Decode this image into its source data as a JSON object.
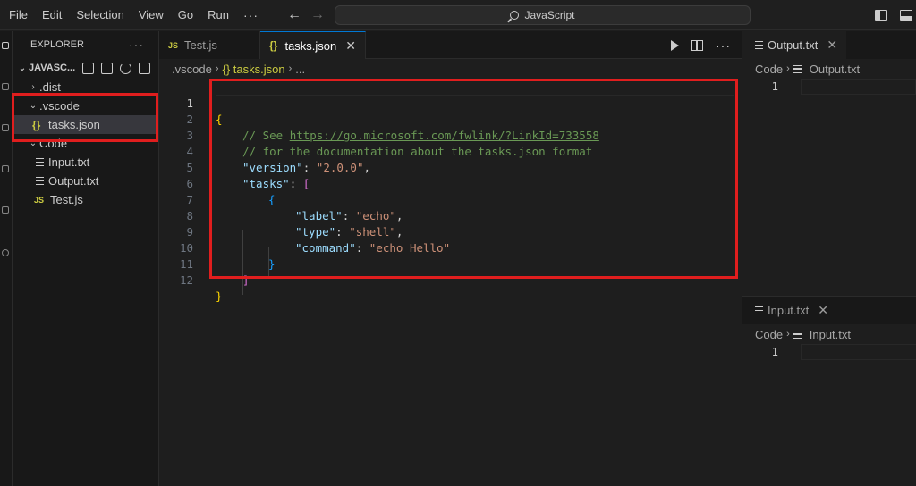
{
  "menu": [
    "File",
    "Edit",
    "Selection",
    "View",
    "Go",
    "Run",
    "···"
  ],
  "nav": {
    "back": "←",
    "forward": "→"
  },
  "command_center": {
    "text": "JavaScript"
  },
  "sidebar": {
    "header": "EXPLORER",
    "more": "···",
    "section": "JAVASC...",
    "tree": [
      {
        "label": ".dist",
        "kind": "folder-collapsed",
        "depth": 1
      },
      {
        "label": ".vscode",
        "kind": "folder-open",
        "depth": 1
      },
      {
        "label": "tasks.json",
        "kind": "json",
        "depth": 2,
        "selected": true
      },
      {
        "label": "Code",
        "kind": "folder-open",
        "depth": 1
      },
      {
        "label": "Input.txt",
        "kind": "text",
        "depth": 2
      },
      {
        "label": "Output.txt",
        "kind": "text",
        "depth": 2
      },
      {
        "label": "Test.js",
        "kind": "js",
        "depth": 2
      }
    ]
  },
  "editor": {
    "tabs": [
      {
        "label": "Test.js",
        "icon": "JS",
        "active": false
      },
      {
        "label": "tasks.json",
        "icon": "{}",
        "active": true,
        "close": "✕"
      }
    ],
    "breadcrumb": [
      ".vscode",
      "{} tasks.json",
      "..."
    ],
    "line_numbers": [
      "1",
      "2",
      "3",
      "4",
      "5",
      "6",
      "7",
      "8",
      "9",
      "10",
      "11",
      "12"
    ],
    "code": {
      "l1": "{",
      "l2_comment": "// See ",
      "l2_link": "https://go.microsoft.com/fwlink/?LinkId=733558",
      "l3": "// for the documentation about the tasks.json format",
      "l4_key": "\"version\"",
      "l4_val": "\"2.0.0\"",
      "l5_key": "\"tasks\"",
      "l5_open": "[",
      "l6": "{",
      "l7_key": "\"label\"",
      "l7_val": "\"echo\"",
      "l8_key": "\"type\"",
      "l8_val": "\"shell\"",
      "l9_key": "\"command\"",
      "l9_val": "\"echo Hello\"",
      "l10": "}",
      "l11": "]",
      "l12": "}"
    }
  },
  "right_top": {
    "tab": "Output.txt",
    "close": "✕",
    "breadcrumb": [
      "Code",
      "Output.txt"
    ],
    "line": "1"
  },
  "right_bottom": {
    "tab": "Input.txt",
    "close": "✕",
    "breadcrumb": [
      "Code",
      "Input.txt"
    ],
    "line": "1"
  },
  "colors": {
    "highlight": "#e01e1e",
    "accent": "#0078d4"
  }
}
